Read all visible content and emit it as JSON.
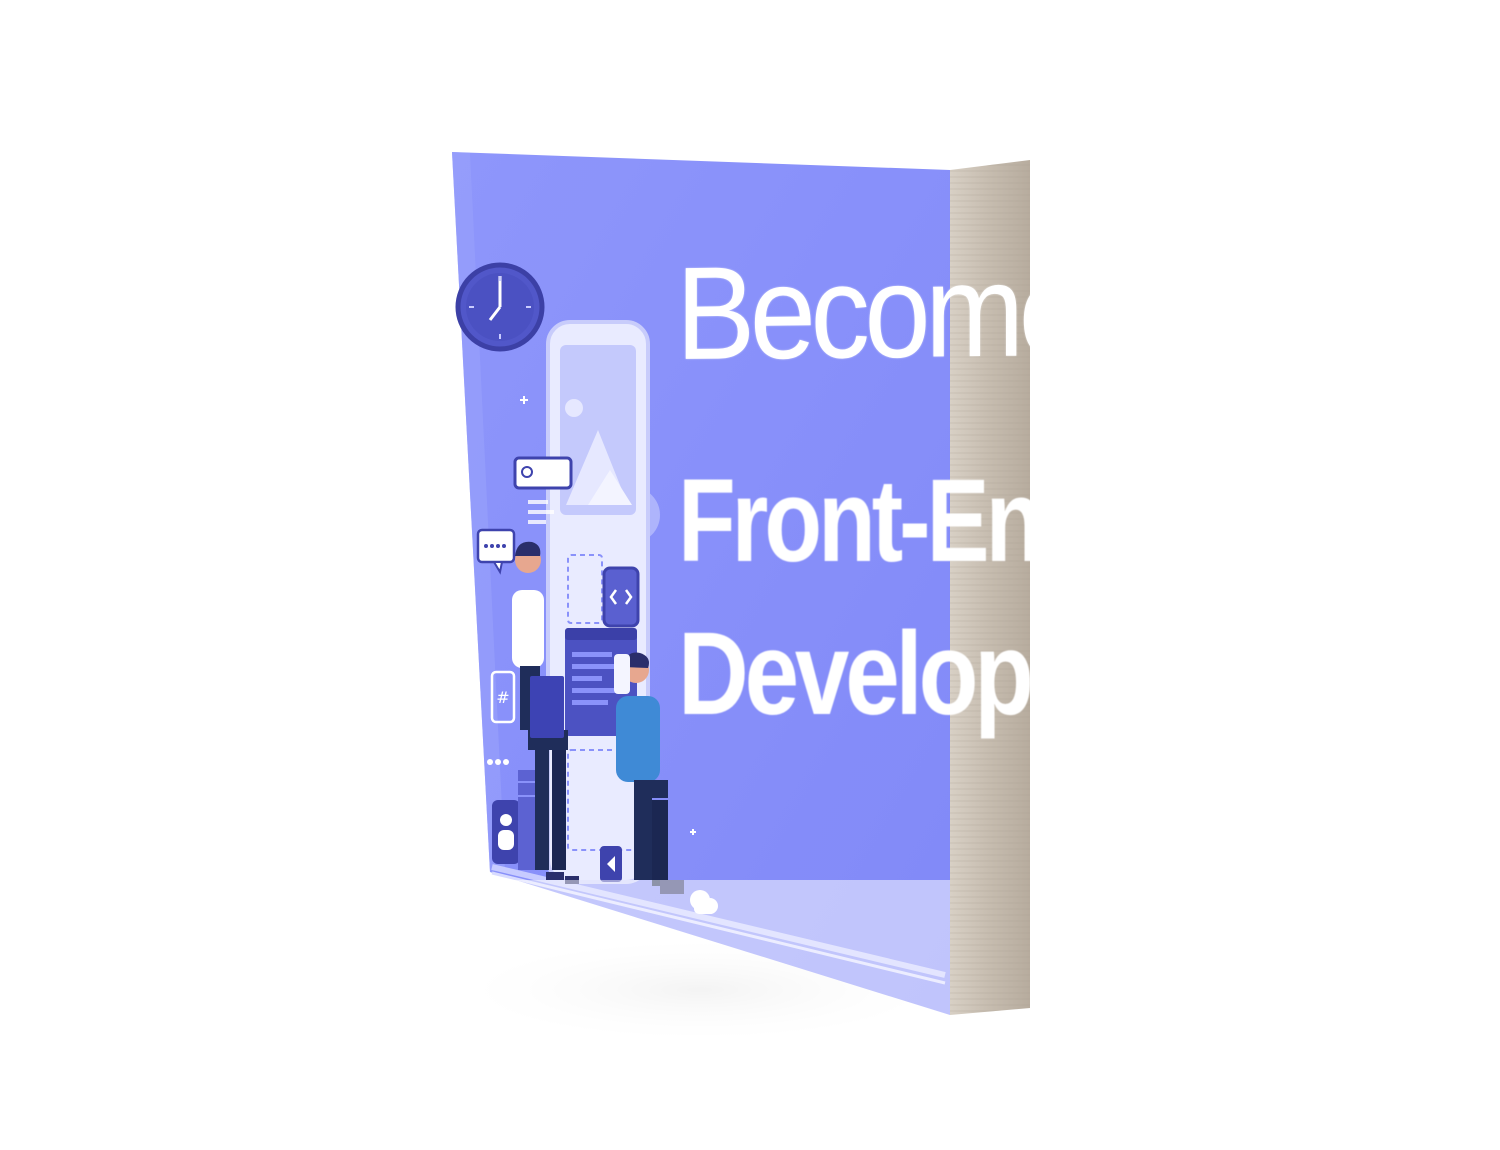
{
  "cover": {
    "title_line1": "Become a",
    "title_line2": "Front-End",
    "title_line3": "Developer"
  },
  "illustration": {
    "search_box_icon": "search-icon",
    "chat_bubble_icon": "chat-bubble-icon",
    "hashtag_icon": "hashtag-icon",
    "code_icon": "code-brackets-icon",
    "user_icon": "user-icon",
    "play_icon": "back-arrow-icon",
    "clock_icon": "clock-icon",
    "gear_icon": "gear-icon"
  },
  "colors": {
    "cover_bg": "#8a92fa",
    "cover_dark": "#3f44b0",
    "page_edge": "#c9c0b4",
    "text": "#ffffff"
  }
}
